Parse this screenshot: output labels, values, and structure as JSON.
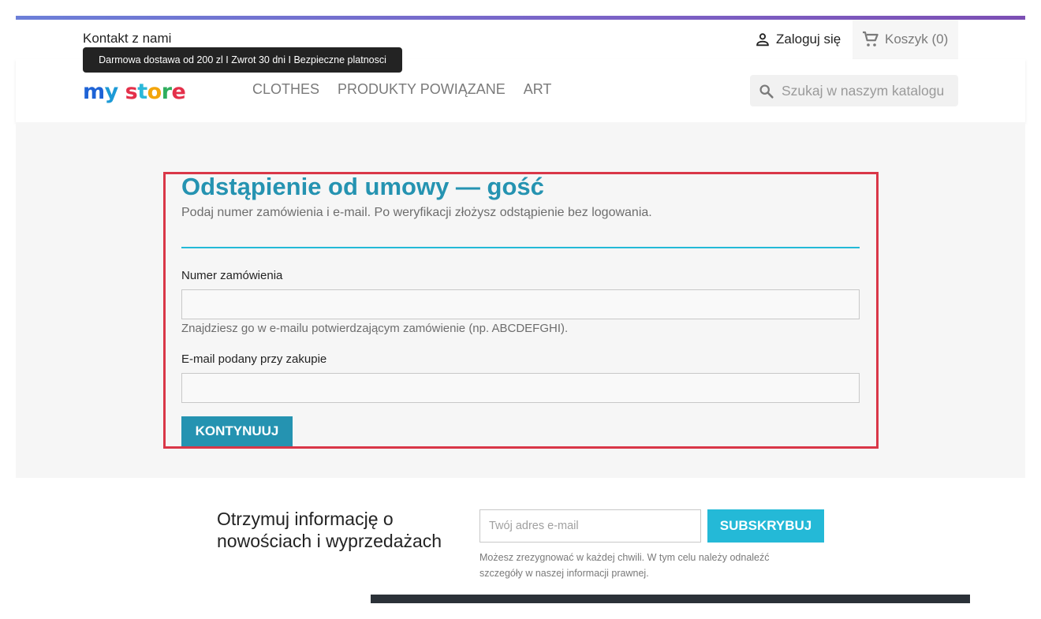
{
  "header": {
    "contact_label": "Kontakt z nami",
    "login_label": "Zaloguj się",
    "cart_label": "Koszyk (0)",
    "banner_text": "Darmowa dostawa od 200 zl I Zwrot 30 dni I Bezpieczne platnosci",
    "logo_parts": [
      "m",
      "y",
      "s",
      "t",
      "o",
      "r",
      "e"
    ],
    "menu": [
      "CLOTHES",
      "PRODUKTY POWIĄZANE",
      "ART"
    ],
    "search_placeholder": "Szukaj w naszym katalogu",
    "accent_gradient": [
      "#6c7fd8",
      "#7c4fb4"
    ]
  },
  "form": {
    "title": "Odstąpienie od umowy — gość",
    "subtitle": "Podaj numer zamówienia i e-mail. Po weryfikacji złożysz odstąpienie bez logowania.",
    "order_label": "Numer zamówienia",
    "order_value": "",
    "order_hint": "Znajdziesz go w e-mailu potwierdzającym zamówienie (np. ABCDEFGHI).",
    "email_label": "E-mail podany przy zakupie",
    "email_value": "",
    "submit_label": "KONTYNUUJ",
    "accent_color": "#2593b1",
    "highlight_border": "#d93748"
  },
  "newsletter": {
    "title": "Otrzymuj informację o nowościach i wyprzedażach",
    "placeholder": "Twój adres e-mail",
    "button_label": "SUBSKRYBUJ",
    "note": "Możesz zrezygnować w każdej chwili. W tym celu należy odnaleźć szczegóły w naszej informacji prawnej.",
    "button_color": "#24b9d7"
  },
  "icons": {
    "login": "person-icon",
    "cart": "shopping-cart-icon",
    "search": "search-icon"
  }
}
